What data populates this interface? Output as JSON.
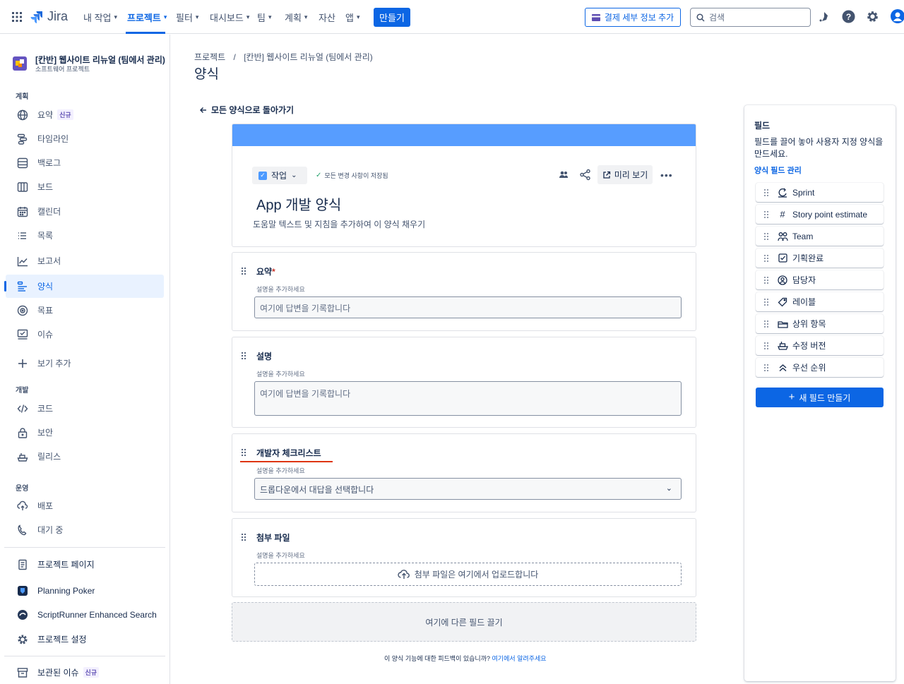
{
  "app": {
    "name": "Jira"
  },
  "topnav": {
    "items": [
      {
        "label": "내 작업"
      },
      {
        "label": "프로젝트"
      },
      {
        "label": "필터"
      },
      {
        "label": "대시보드"
      },
      {
        "label": "팀"
      },
      {
        "label": "계획"
      },
      {
        "label": "자산"
      },
      {
        "label": "앱"
      }
    ],
    "create_label": "만들기",
    "billing_label": "결제 세부 정보 추가",
    "search_placeholder": "검색"
  },
  "sidebar": {
    "project_name": "[칸반] 웹사이트 리뉴얼 (팀에서 관리)",
    "project_type": "소프트웨어 프로젝트",
    "sections": {
      "plan": "계획",
      "dev": "개발",
      "ops": "운영"
    },
    "items": [
      {
        "label": "요약",
        "badge": "신규",
        "icon": "globe-icon"
      },
      {
        "label": "타임라인",
        "icon": "timeline-icon"
      },
      {
        "label": "백로그",
        "icon": "backlog-icon"
      },
      {
        "label": "보드",
        "icon": "board-icon"
      },
      {
        "label": "캘린더",
        "icon": "calendar-icon"
      },
      {
        "label": "목록",
        "icon": "list-icon"
      },
      {
        "label": "보고서",
        "icon": "reports-icon"
      },
      {
        "label": "양식",
        "icon": "forms-icon"
      },
      {
        "label": "목표",
        "icon": "goal-icon"
      },
      {
        "label": "이슈",
        "icon": "issues-icon"
      },
      {
        "label": "보기 추가",
        "icon": "plus-icon"
      },
      {
        "label": "코드",
        "icon": "code-icon"
      },
      {
        "label": "보안",
        "icon": "lock-icon"
      },
      {
        "label": "릴리스",
        "icon": "ship-icon"
      },
      {
        "label": "배포",
        "icon": "cloud-icon"
      },
      {
        "label": "대기 중",
        "icon": "phone-icon"
      },
      {
        "label": "프로젝트 페이지",
        "icon": "page-icon"
      },
      {
        "label": "Planning Poker",
        "icon": "poker-icon"
      },
      {
        "label": "ScriptRunner Enhanced Search",
        "icon": "scriptrunner-icon"
      },
      {
        "label": "프로젝트 설정",
        "icon": "gear-icon"
      },
      {
        "label": "보관된 이슈",
        "badge": "신규",
        "icon": "archive-icon"
      }
    ]
  },
  "main": {
    "breadcrumb": {
      "root": "프로젝트",
      "sep": "/",
      "project": "[칸반] 웹사이트 리뉴얼 (팀에서 관리)"
    },
    "title": "양식",
    "back_label": "모든 양식으로 돌아가기",
    "form": {
      "issue_type": "작업",
      "saved_status": "모든 변경 사항이 저장됨",
      "preview_label": "미리 보기",
      "title": "App 개발 양식",
      "description": "도움말 텍스트 및 지침을 추가하여 이 양식 채우기",
      "fields": [
        {
          "label": "요약",
          "required": "*",
          "help": "설명을 추가하세요",
          "placeholder": "여기에 답변을 기록합니다"
        },
        {
          "label": "설명",
          "help": "설명을 추가하세요",
          "placeholder": "여기에 답변을 기록합니다"
        },
        {
          "label": "개발자 체크리스트",
          "help": "설명을 추가하세요",
          "placeholder": "드롭다운에서 대답을 선택합니다"
        },
        {
          "label": "첨부 파일",
          "help": "설명을 추가하세요",
          "placeholder": "첨부 파일은 여기에서 업로드합니다"
        }
      ],
      "drop_zone": "여기에 다른 필드 끌기",
      "feedback_text": "이 양식 기능에 대한 피드백이 있습니까?",
      "feedback_link": "여기에서 알려주세요"
    }
  },
  "fields_panel": {
    "title": "필드",
    "description": "필드를 끌어 놓아 사용자 지정 양식을 만드세요.",
    "manage_link": "양식 필드 관리",
    "items": [
      {
        "label": "Sprint",
        "icon": "sprint-icon"
      },
      {
        "label": "Story point estimate",
        "icon": "hash-icon"
      },
      {
        "label": "Team",
        "icon": "team-icon"
      },
      {
        "label": "기획완료",
        "icon": "checkbox-icon"
      },
      {
        "label": "담당자",
        "icon": "user-icon"
      },
      {
        "label": "레이블",
        "icon": "label-icon"
      },
      {
        "label": "상위 항목",
        "icon": "parent-icon"
      },
      {
        "label": "수정 버전",
        "icon": "ship-icon"
      },
      {
        "label": "우선 순위",
        "icon": "priority-icon"
      }
    ],
    "new_field_label": "새 필드 만들기"
  },
  "colors": {
    "accent": "#0c66e4",
    "banner": "#579dff",
    "annotation": "#de350b"
  }
}
